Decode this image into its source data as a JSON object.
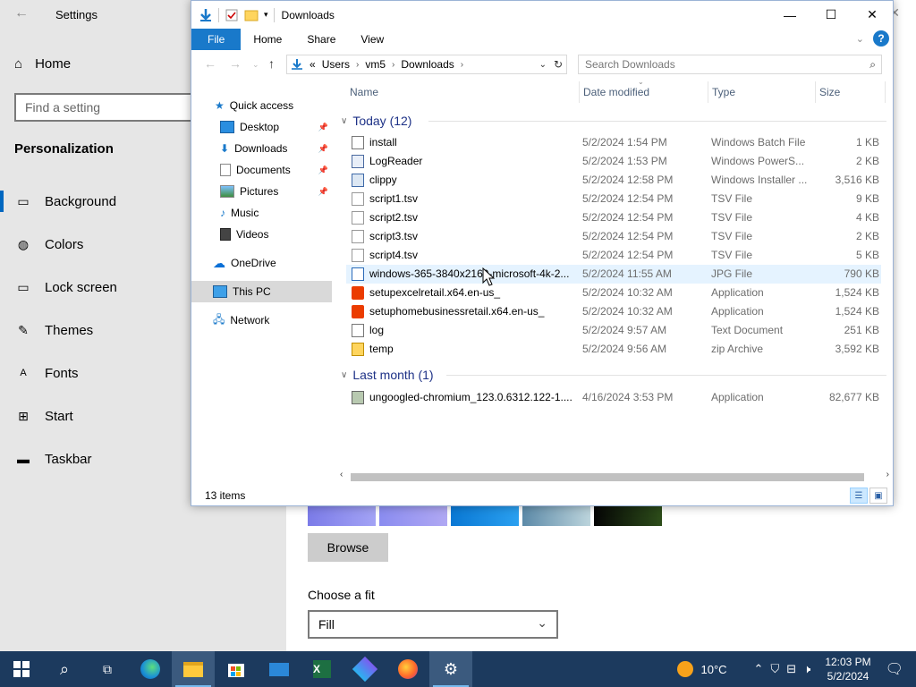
{
  "settings": {
    "title": "Settings",
    "home": "Home",
    "search_placeholder": "Find a setting",
    "section": "Personalization",
    "nav": [
      {
        "label": "Background",
        "icon": "image-icon"
      },
      {
        "label": "Colors",
        "icon": "palette-icon"
      },
      {
        "label": "Lock screen",
        "icon": "lock-screen-icon"
      },
      {
        "label": "Themes",
        "icon": "brush-icon"
      },
      {
        "label": "Fonts",
        "icon": "font-icon"
      },
      {
        "label": "Start",
        "icon": "start-grid-icon"
      },
      {
        "label": "Taskbar",
        "icon": "taskbar-icon"
      }
    ],
    "browse": "Browse",
    "fit_label": "Choose a fit",
    "fit_value": "Fill"
  },
  "explorer": {
    "title": "Downloads",
    "ribbon_tabs": [
      "File",
      "Home",
      "Share",
      "View"
    ],
    "breadcrumb": [
      "Users",
      "vm5",
      "Downloads"
    ],
    "breadcrumb_prefix": "«",
    "search_placeholder": "Search Downloads",
    "nav_pane": {
      "quick_access": "Quick access",
      "pinned": [
        "Desktop",
        "Downloads",
        "Documents",
        "Pictures"
      ],
      "unpinned": [
        "Music",
        "Videos"
      ],
      "onedrive": "OneDrive",
      "this_pc": "This PC",
      "network": "Network"
    },
    "columns": {
      "name": "Name",
      "date": "Date modified",
      "type": "Type",
      "size": "Size"
    },
    "groups": [
      {
        "label": "Today (12)",
        "files": [
          {
            "name": "install",
            "date": "5/2/2024 1:54 PM",
            "type": "Windows Batch File",
            "size": "1 KB"
          },
          {
            "name": "LogReader",
            "date": "5/2/2024 1:53 PM",
            "type": "Windows PowerS...",
            "size": "2 KB"
          },
          {
            "name": "clippy",
            "date": "5/2/2024 12:58 PM",
            "type": "Windows Installer ...",
            "size": "3,516 KB"
          },
          {
            "name": "script1.tsv",
            "date": "5/2/2024 12:54 PM",
            "type": "TSV File",
            "size": "9 KB"
          },
          {
            "name": "script2.tsv",
            "date": "5/2/2024 12:54 PM",
            "type": "TSV File",
            "size": "4 KB"
          },
          {
            "name": "script3.tsv",
            "date": "5/2/2024 12:54 PM",
            "type": "TSV File",
            "size": "2 KB"
          },
          {
            "name": "script4.tsv",
            "date": "5/2/2024 12:54 PM",
            "type": "TSV File",
            "size": "5 KB"
          },
          {
            "name": "windows-365-3840x2160-microsoft-4k-2...",
            "date": "5/2/2024 11:55 AM",
            "type": "JPG File",
            "size": "790 KB"
          },
          {
            "name": "setupexcelretail.x64.en-us_",
            "date": "5/2/2024 10:32 AM",
            "type": "Application",
            "size": "1,524 KB"
          },
          {
            "name": "setuphomebusinessretail.x64.en-us_",
            "date": "5/2/2024 10:32 AM",
            "type": "Application",
            "size": "1,524 KB"
          },
          {
            "name": "log",
            "date": "5/2/2024 9:57 AM",
            "type": "Text Document",
            "size": "251 KB"
          },
          {
            "name": "temp",
            "date": "5/2/2024 9:56 AM",
            "type": "zip Archive",
            "size": "3,592 KB"
          }
        ]
      },
      {
        "label": "Last month (1)",
        "files": [
          {
            "name": "ungoogled-chromium_123.0.6312.122-1....",
            "date": "4/16/2024 3:53 PM",
            "type": "Application",
            "size": "82,677 KB"
          }
        ]
      }
    ],
    "status": "13 items"
  },
  "taskbar": {
    "weather": "10°C",
    "time": "12:03 PM",
    "date": "5/2/2024"
  },
  "colors": {
    "accent": "#1979ca",
    "taskbar": "#1c3a5e",
    "group_header": "#1e3287",
    "hover_row": "#e5f3ff"
  }
}
